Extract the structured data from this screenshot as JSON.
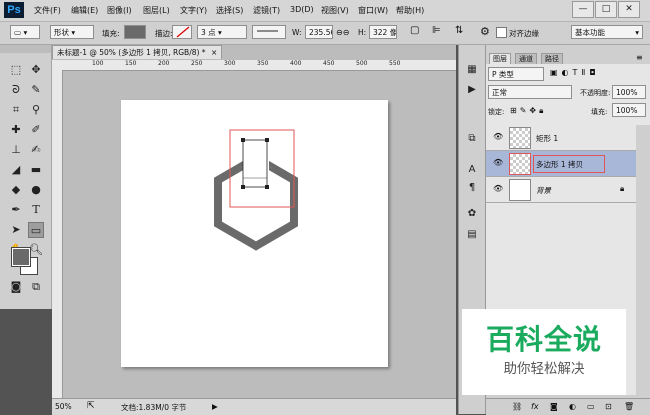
{
  "app": {
    "logo": "Ps"
  },
  "menu": [
    "文件(F)",
    "编辑(E)",
    "图像(I)",
    "图层(L)",
    "文字(Y)",
    "选择(S)",
    "滤镜(T)",
    "3D(D)",
    "视图(V)",
    "窗口(W)",
    "帮助(H)"
  ],
  "window_controls": {
    "minimize": "—",
    "maximize": "□",
    "close": "✕"
  },
  "options": {
    "mode": "形状",
    "fill_label": "填充:",
    "stroke_label": "描边:",
    "stroke_width": "3 点",
    "w_label": "W:",
    "w_value": "235.56",
    "link": "⊖⊖",
    "h_label": "H:",
    "h_value": "322 像",
    "align_edges": "对齐边缘",
    "workspace": "基本功能"
  },
  "document": {
    "tab_title": "未标题-1 @ 50% (多边形 1 拷贝, RGB/8) *",
    "tab_close": "×",
    "ruler_ticks": [
      "100",
      "150",
      "200",
      "250",
      "300",
      "350",
      "400",
      "450",
      "500",
      "550"
    ],
    "zoom": "50%",
    "doc_info": "文档:1.83M/0 字节"
  },
  "layers_panel": {
    "tabs": [
      "图层",
      "通道",
      "路径"
    ],
    "kind_filter": "P 类型",
    "blend_mode": "正常",
    "opacity_label": "不透明度:",
    "opacity": "100%",
    "lock_label": "锁定:",
    "fill_label": "填充:",
    "fill": "100%",
    "layers": [
      {
        "name": "矩形 1",
        "visible": true,
        "selected": false
      },
      {
        "name": "多边形 1 拷贝",
        "visible": true,
        "selected": true
      },
      {
        "name": "背景",
        "visible": true,
        "selected": false,
        "locked": true
      }
    ],
    "footer_icons": [
      "link-icon",
      "fx-icon",
      "mask-icon",
      "adjustment-icon",
      "group-icon",
      "new-layer-icon",
      "trash-icon"
    ]
  },
  "watermark": {
    "title": "百科全说",
    "subtitle": "助你轻松解决"
  },
  "colors": {
    "accent": "#31a8ff",
    "selected_layer": "#a8b6d8",
    "selection_path": "#e05555",
    "shape": "#6a6a6a",
    "watermark": "#1aab5e"
  }
}
